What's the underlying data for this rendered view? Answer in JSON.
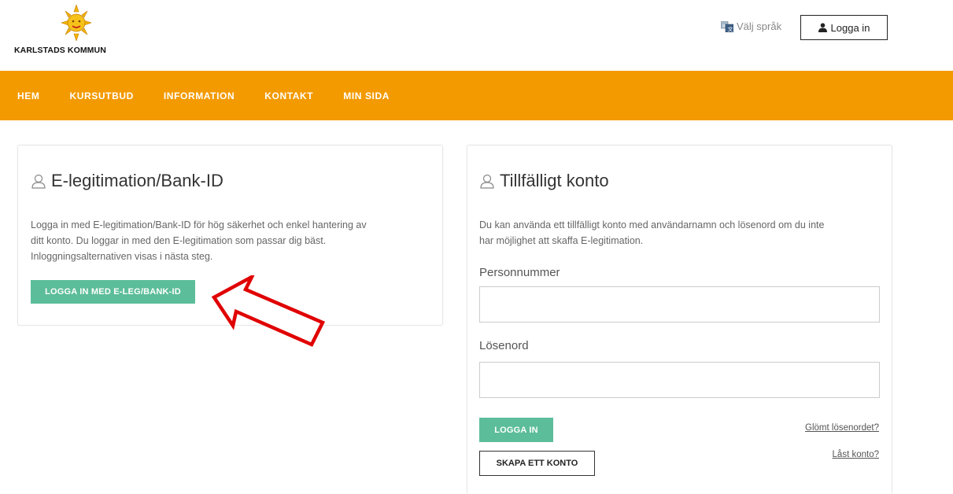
{
  "header": {
    "logo_text": "KARLSTADS KOMMUN",
    "lang_label": "Välj språk",
    "login_label": "Logga in"
  },
  "nav": {
    "items": [
      "HEM",
      "KURSUTBUD",
      "INFORMATION",
      "KONTAKT",
      "MIN SIDA"
    ]
  },
  "eleg_card": {
    "title": "E-legitimation/Bank-ID",
    "text_lines": [
      "Logga in med E-legitimation/Bank-ID för hög säkerhet och enkel hantering av",
      "ditt konto. Du loggar in med den E-legitimation som passar dig bäst.",
      "Inloggningsalternativen visas i nästa steg."
    ],
    "button_label": "LOGGA IN MED E-LEG/BANK-ID"
  },
  "temp_card": {
    "title": "Tillfälligt konto",
    "text_lines": [
      "Du kan använda ett tillfälligt konto med användarnamn och lösenord om du inte",
      "har möjlighet att skaffa E-legitimation."
    ],
    "personnummer_label": "Personnummer",
    "personnummer_value": "",
    "password_label": "Lösenord",
    "password_value": "",
    "login_button": "LOGGA IN",
    "create_button": "SKAPA ETT KONTO",
    "forgot_link": "Glömt lösenordet?",
    "locked_link": "Låst konto?"
  },
  "colors": {
    "nav_bg": "#f39a00",
    "green_button": "#5cbd9a",
    "arrow": "#e00000"
  },
  "icons": [
    "sun-logo-icon",
    "translate-icon",
    "user-icon",
    "outline-user-icon",
    "red-arrow-icon"
  ]
}
